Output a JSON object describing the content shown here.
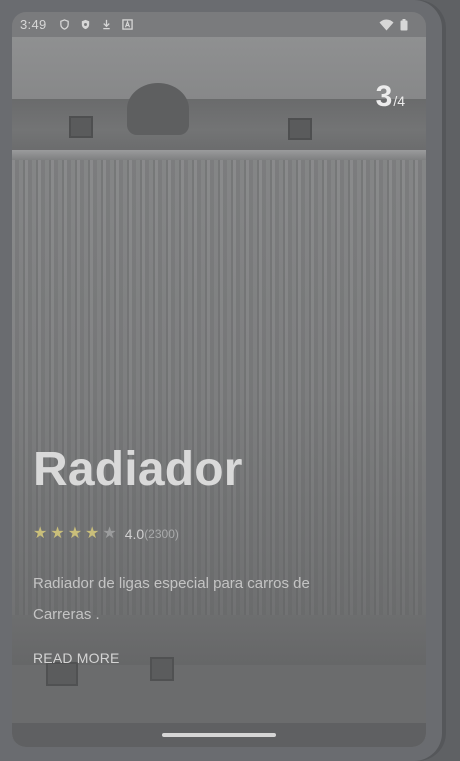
{
  "status_bar": {
    "time": "3:49",
    "left_icons": [
      "shield-outline-icon",
      "shield-filled-icon",
      "download-arrow-icon",
      "a-badge-icon"
    ],
    "right_icons": [
      "wifi-icon",
      "battery-icon"
    ]
  },
  "carousel": {
    "current": "3",
    "separator": "/",
    "total": "4"
  },
  "product": {
    "title": "Radiador",
    "rating": {
      "value": "4.0",
      "count": "(2300)",
      "stars_filled": 4,
      "stars_total": 5
    },
    "description": "Radiador de ligas especial para carros de Carreras .",
    "read_more_label": "READ MORE"
  },
  "colors": {
    "star_filled": "#c9be7a",
    "star_empty": "#9b9c9d",
    "title_text": "#d9d9d9"
  }
}
